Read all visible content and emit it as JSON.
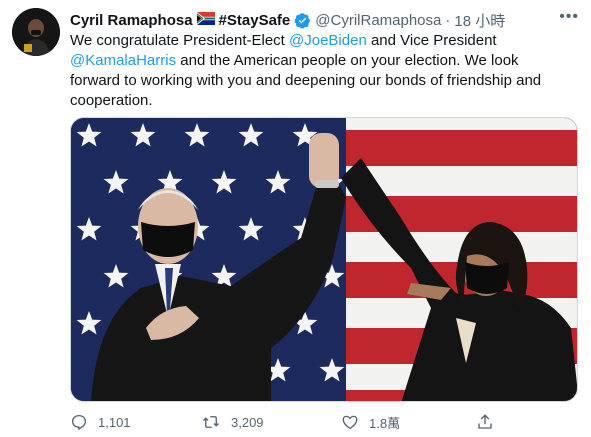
{
  "tweet": {
    "display_name": "Cyril Ramaphosa",
    "hashtag": "#StaySafe",
    "handle": "@CyrilRamaphosa",
    "separator": "·",
    "time": "18 小時",
    "more_label": "•••",
    "text": {
      "part1": "We congratulate President-Elect ",
      "mention1": "@JoeBiden",
      "part2": " and Vice President ",
      "mention2": "@KamalaHarris",
      "part3": " and the American people on your election. We look forward to working with you and deepening our bonds of friendship and cooperation."
    },
    "media_alt": "Photo: Joe Biden and Kamala Harris raising joined hands in front of an American flag",
    "actions": {
      "reply_count": "1,101",
      "retweet_count": "3,209",
      "like_count": "1.8萬"
    }
  },
  "colors": {
    "link": "#1d9bf0",
    "secondary": "#536471",
    "verified": "#1d9bf0"
  }
}
